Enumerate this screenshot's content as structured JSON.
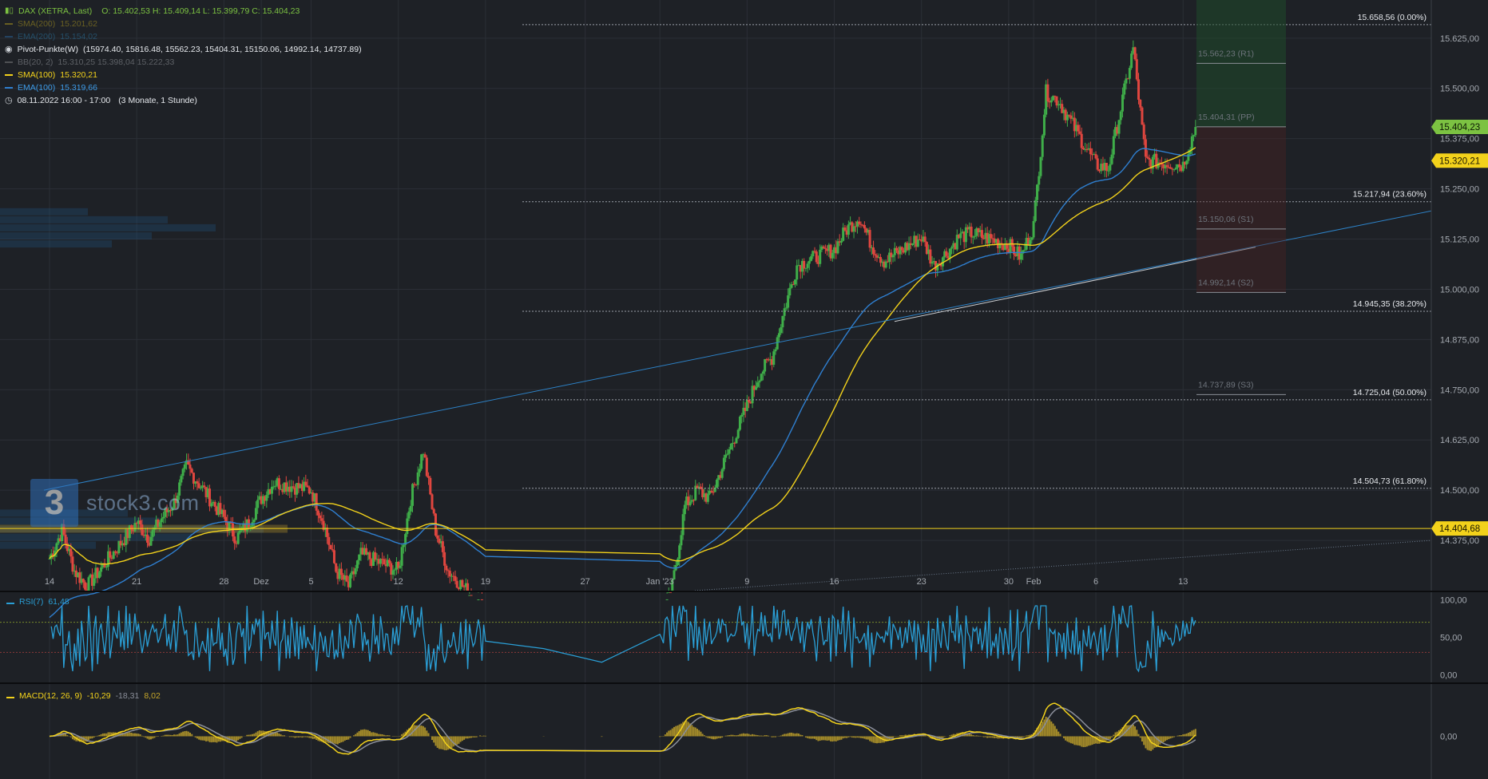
{
  "header": {
    "instrument": "DAX (XETRA, Last)",
    "ohlc": "O: 15.402,53  H: 15.409,14  L: 15.399,79  C: 15.404,23",
    "sma200_label": "SMA(200)",
    "sma200_value": "15.201,62",
    "ema200_label": "EMA(200)",
    "ema200_value": "15.154,02",
    "pivot_label": "Pivot-Punkte(W)",
    "pivot_values": "(15974.40,  15816.48,  15562.23,  15404.31,  15150.06,  14992.14,  14737.89)",
    "bb_label": "BB(20, 2)",
    "bb_value": "15.310,25  15.398,04  15.222,33",
    "sma100_label": "SMA(100)",
    "sma100_value": "15.320,21",
    "ema100_label": "EMA(100)",
    "ema100_value": "15.319,66",
    "time_label": "08.11.2022 16:00 - 17:00",
    "range_label": "(3 Monate, 1 Stunde)"
  },
  "logo_text": "stock3.com",
  "colors": {
    "background": "#1e2126",
    "up": "#3fae49",
    "down": "#e0463f",
    "sma": "#f3d21b",
    "ema": "#2f7fd0",
    "rsi": "#2a9fd6",
    "macd": "#f3d21b",
    "signal": "#8b8f9a",
    "hist": "#c5a62a",
    "price_tag": "#7cc242"
  },
  "chart_data": [
    {
      "type": "candlestick",
      "title": "DAX (XETRA, Last)",
      "ylim": [
        14250,
        15720
      ],
      "y_ticks": [
        14375,
        14500,
        14625,
        14750,
        14875,
        15000,
        15125,
        15250,
        15375,
        15500,
        15625
      ],
      "y_tick_labels": [
        "14.375,00",
        "14.500,00",
        "14.625,00",
        "14.750,00",
        "14.875,00",
        "15.000,00",
        "15.125,00",
        "15.250,00",
        "15.375,00",
        "15.500,00",
        "15.625,00"
      ],
      "x_range": [
        "2022-11-14",
        "2023-02-16"
      ],
      "x_ticks": [
        {
          "date": "2022-11-14",
          "label": "14"
        },
        {
          "date": "2022-11-21",
          "label": "21"
        },
        {
          "date": "2022-11-28",
          "label": "28"
        },
        {
          "date": "2022-12-01",
          "label": "Dez"
        },
        {
          "date": "2022-12-05",
          "label": "5"
        },
        {
          "date": "2022-12-12",
          "label": "12"
        },
        {
          "date": "2022-12-19",
          "label": "19"
        },
        {
          "date": "2022-12-27",
          "label": "27"
        },
        {
          "date": "2023-01-02",
          "label": "Jan '23"
        },
        {
          "date": "2023-01-09",
          "label": "9"
        },
        {
          "date": "2023-01-16",
          "label": "16"
        },
        {
          "date": "2023-01-23",
          "label": "23"
        },
        {
          "date": "2023-01-30",
          "label": "30"
        },
        {
          "date": "2023-02-01",
          "label": "Feb"
        },
        {
          "date": "2023-02-06",
          "label": "6"
        },
        {
          "date": "2023-02-13",
          "label": "13"
        }
      ],
      "price_path": [
        [
          "2022-11-14",
          14330
        ],
        [
          "2022-11-15",
          14400
        ],
        [
          "2022-11-16",
          14300
        ],
        [
          "2022-11-17",
          14260
        ],
        [
          "2022-11-21",
          14420
        ],
        [
          "2022-11-22",
          14380
        ],
        [
          "2022-11-23",
          14430
        ],
        [
          "2022-11-24",
          14470
        ],
        [
          "2022-11-25",
          14560
        ],
        [
          "2022-11-28",
          14430
        ],
        [
          "2022-11-29",
          14380
        ],
        [
          "2022-11-30",
          14420
        ],
        [
          "2022-12-01",
          14480
        ],
        [
          "2022-12-02",
          14520
        ],
        [
          "2022-12-05",
          14500
        ],
        [
          "2022-12-06",
          14420
        ],
        [
          "2022-12-07",
          14300
        ],
        [
          "2022-12-08",
          14260
        ],
        [
          "2022-12-09",
          14340
        ],
        [
          "2022-12-12",
          14300
        ],
        [
          "2022-12-13",
          14480
        ],
        [
          "2022-12-14",
          14600
        ],
        [
          "2022-12-15",
          14400
        ],
        [
          "2022-12-16",
          14300
        ],
        [
          "2022-12-19",
          14200
        ],
        [
          "2023-01-02",
          14150
        ],
        [
          "2023-01-03",
          14260
        ],
        [
          "2023-01-04",
          14460
        ],
        [
          "2023-01-05",
          14500
        ],
        [
          "2023-01-06",
          14480
        ],
        [
          "2023-01-09",
          14710
        ],
        [
          "2023-01-10",
          14790
        ],
        [
          "2023-01-11",
          14830
        ],
        [
          "2023-01-12",
          14950
        ],
        [
          "2023-01-13",
          15060
        ],
        [
          "2023-01-16",
          15100
        ],
        [
          "2023-01-17",
          15150
        ],
        [
          "2023-01-18",
          15180
        ],
        [
          "2023-01-19",
          15110
        ],
        [
          "2023-01-20",
          15070
        ],
        [
          "2023-01-23",
          15130
        ],
        [
          "2023-01-24",
          15060
        ],
        [
          "2023-01-25",
          15090
        ],
        [
          "2023-01-26",
          15130
        ],
        [
          "2023-01-27",
          15140
        ],
        [
          "2023-01-30",
          15110
        ],
        [
          "2023-01-31",
          15080
        ],
        [
          "2023-02-01",
          15160
        ],
        [
          "2023-02-02",
          15490
        ],
        [
          "2023-02-03",
          15470
        ],
        [
          "2023-02-06",
          15310
        ],
        [
          "2023-02-07",
          15300
        ],
        [
          "2023-02-08",
          15450
        ],
        [
          "2023-02-09",
          15600
        ],
        [
          "2023-02-10",
          15320
        ],
        [
          "2023-02-13",
          15310
        ],
        [
          "2023-02-14",
          15404
        ]
      ],
      "last_price": {
        "value": 15404.23,
        "label": "15.404,23"
      },
      "sma100_last": {
        "value": 15320.21,
        "label": "15.320,21"
      },
      "horizontal_level": {
        "value": 14404.68,
        "label": "14.404,68"
      },
      "fibonacci": [
        {
          "value": 15658.56,
          "label": "15.658,56 (0.00%)"
        },
        {
          "value": 15217.94,
          "label": "15.217,94 (23.60%)"
        },
        {
          "value": 14945.35,
          "label": "14.945,35 (38.20%)"
        },
        {
          "value": 14725.04,
          "label": "14.725,04 (50.00%)"
        },
        {
          "value": 14504.73,
          "label": "14.504,73 (61.80%)"
        }
      ],
      "pivots": [
        {
          "value": 15562.23,
          "label": "15.562,23 (R1)"
        },
        {
          "value": 15404.31,
          "label": "15.404,31 (PP)"
        },
        {
          "value": 15150.06,
          "label": "15.150,06 (S1)"
        },
        {
          "value": 14992.14,
          "label": "14.992,14 (S2)"
        },
        {
          "value": 14737.89,
          "label": "14.737,89 (S3)"
        }
      ]
    },
    {
      "type": "line",
      "title": "RSI(7)",
      "last_value": "61,48",
      "ylim": [
        -10,
        110
      ],
      "y_ticks": [
        0,
        50,
        100
      ],
      "y_tick_labels": [
        "0,00",
        "50,00",
        "100,00"
      ],
      "levels": [
        70,
        30
      ]
    },
    {
      "type": "line",
      "title": "MACD(12, 26, 9)",
      "values_label": [
        "-10,29",
        "-18,31",
        "8,02"
      ],
      "y_ticks": [
        0
      ],
      "y_tick_labels": [
        "0,00"
      ]
    }
  ]
}
